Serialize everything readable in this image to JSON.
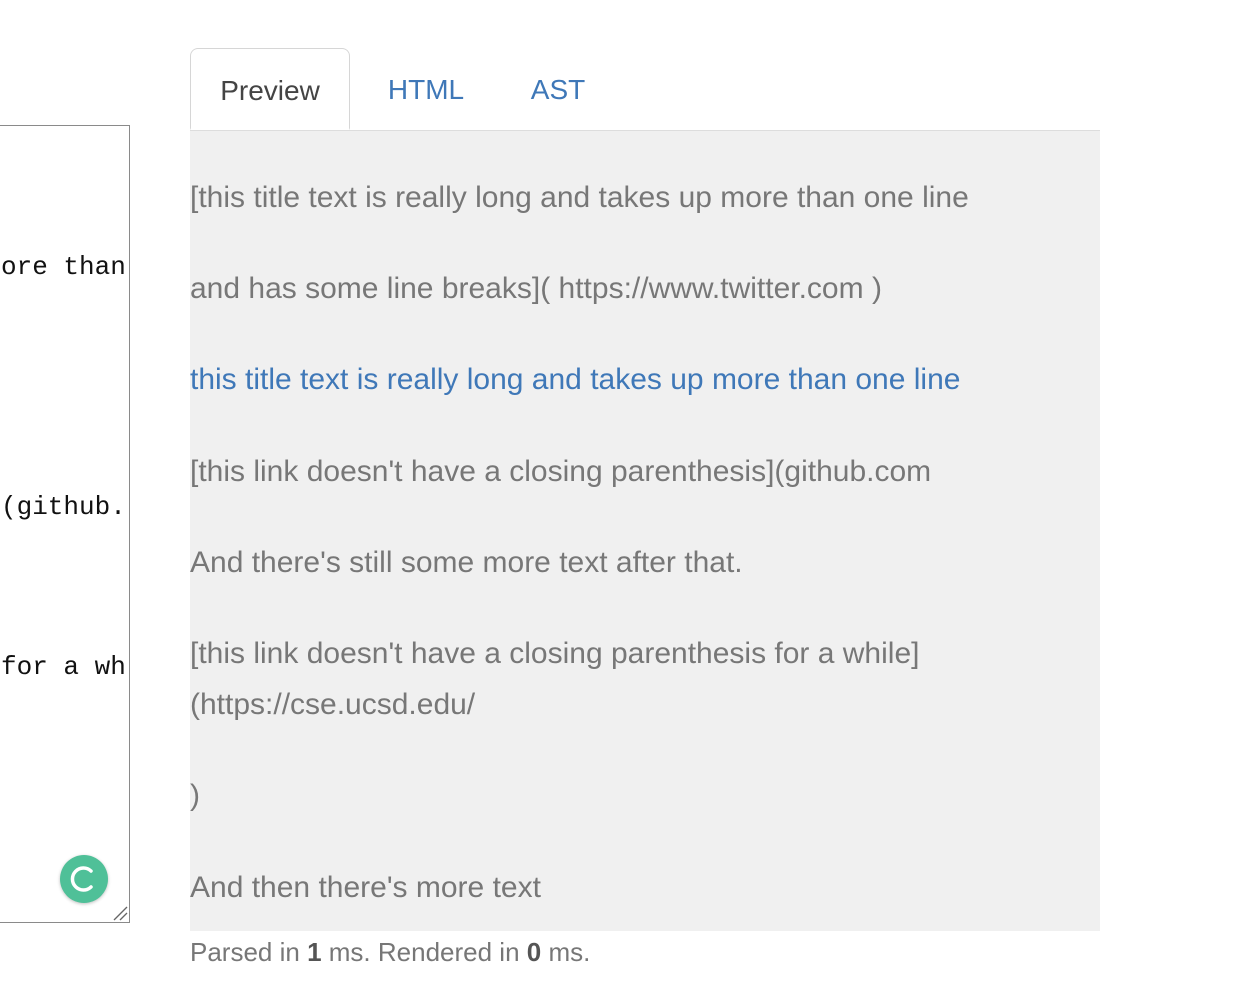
{
  "editor": {
    "lines": [
      "ore than",
      "(github.",
      "for a wh"
    ]
  },
  "tabs": {
    "preview": "Preview",
    "html": "HTML",
    "ast": "AST"
  },
  "preview": {
    "lines": [
      "[this title text is really long and takes up more than one line",
      "and has some line breaks]( https://www.twitter.com )",
      "this title text is really long and takes up more than one line",
      "[this link doesn't have a closing parenthesis](github.com",
      "And there's still some more text after that.",
      "[this link doesn't have a closing parenthesis for a while]",
      "(https://cse.ucsd.edu/",
      ")",
      "And then there's more text"
    ]
  },
  "status": {
    "parsed_prefix": "Parsed in ",
    "parsed_ms": "1",
    "rendered_prefix": " ms. Rendered in ",
    "rendered_ms": "0",
    "suffix": " ms."
  },
  "colors": {
    "link": "#3f78b8",
    "preview_bg": "#f0f0f0",
    "badge": "#4fc098"
  },
  "icons": {
    "badge": "grammarly-icon",
    "grip": "resize-grip-icon"
  }
}
